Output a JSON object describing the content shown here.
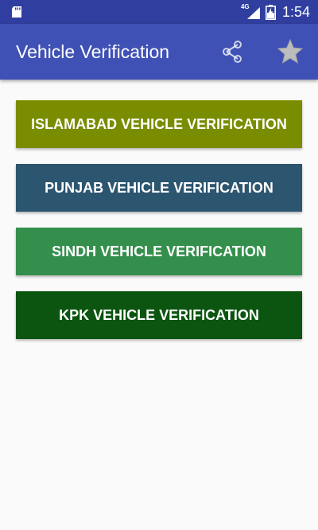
{
  "status_bar": {
    "time": "1:54",
    "network_type": "4G",
    "icons": [
      "sd-card-icon",
      "signal-icon",
      "battery-icon"
    ]
  },
  "app_bar": {
    "title": "Vehicle Verification",
    "actions": [
      "share-icon",
      "star-icon"
    ]
  },
  "buttons": [
    {
      "label": "ISLAMABAD VEHICLE VERIFICATION",
      "color": "#7a8c00"
    },
    {
      "label": "PUNJAB VEHICLE VERIFICATION",
      "color": "#2c5570"
    },
    {
      "label": "SINDH VEHICLE VERIFICATION",
      "color": "#348f4c"
    },
    {
      "label": "KPK VEHICLE VERIFICATION",
      "color": "#0b5510"
    }
  ],
  "colors": {
    "status_bar": "#303f9f",
    "app_bar": "#3f51b5",
    "background": "#fafafa"
  }
}
